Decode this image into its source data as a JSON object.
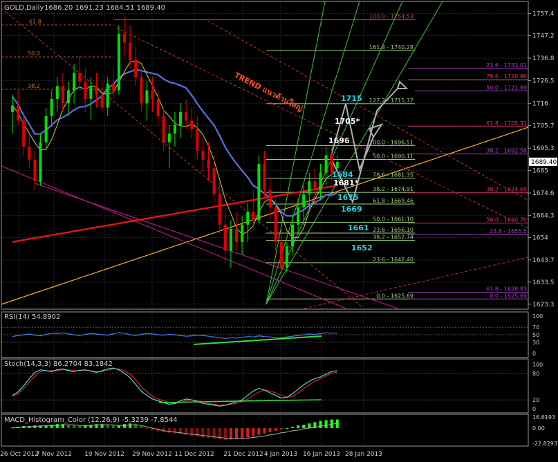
{
  "title": "GOLD,Daily",
  "ohlc_readout": "1686.20 1691.23 1684.51 1689.40",
  "colors": {
    "bg": "#000000",
    "grid": "#2b2b2b",
    "border": "#9a9a9a",
    "bull": "#00e000",
    "bear": "#e00000",
    "ma_blue": "#5a6ee6",
    "ma_red": "#e01818",
    "envelope": "#d01890",
    "fib": "#b05048",
    "trendline": "#ffb020",
    "channel": "#cc2222",
    "projection": "#b0b0b0",
    "fan": "#40c040",
    "cyan_label": "#2ad0e0",
    "white_label": "#ffffff"
  },
  "chart_data": [
    {
      "type": "candlestick",
      "name": "price",
      "x_ticks": [
        "26 Oct 2012",
        "7 Nov 2012",
        "19 Nov 2012",
        "29 Nov 2012",
        "11 Dec 2012",
        "21 Dec 2012",
        "4 Jan 2013",
        "16 Jan 2013",
        "28 Jan 2013"
      ],
      "y_ticks": [
        1757.4,
        1747.2,
        1736.8,
        1726.5,
        1716.0,
        1705.7,
        1695.3,
        1685.0,
        1674.6,
        1664.3,
        1654.0,
        1643.7,
        1633.5,
        1623.3
      ],
      "ylim": [
        1621.0,
        1763.0
      ],
      "current_price": "1689.40",
      "candles": [
        [
          1712,
          1720,
          1702,
          1715
        ],
        [
          1715,
          1722,
          1706,
          1708
        ],
        [
          1708,
          1712,
          1692,
          1696
        ],
        [
          1696,
          1702,
          1686,
          1690
        ],
        [
          1690,
          1694,
          1676,
          1680
        ],
        [
          1680,
          1702,
          1678,
          1698
        ],
        [
          1698,
          1714,
          1694,
          1710
        ],
        [
          1710,
          1722,
          1705,
          1718
        ],
        [
          1718,
          1728,
          1712,
          1724
        ],
        [
          1724,
          1730,
          1712,
          1716
        ],
        [
          1716,
          1726,
          1710,
          1722
        ],
        [
          1722,
          1734,
          1716,
          1730
        ],
        [
          1730,
          1738,
          1722,
          1726
        ],
        [
          1726,
          1732,
          1712,
          1718
        ],
        [
          1718,
          1728,
          1708,
          1724
        ],
        [
          1724,
          1730,
          1714,
          1720
        ],
        [
          1720,
          1726,
          1712,
          1714
        ],
        [
          1714,
          1728,
          1710,
          1725
        ],
        [
          1725,
          1732,
          1718,
          1722
        ],
        [
          1722,
          1752,
          1720,
          1748
        ],
        [
          1748,
          1756,
          1738,
          1744
        ],
        [
          1744,
          1752,
          1732,
          1736
        ],
        [
          1736,
          1742,
          1724,
          1728
        ],
        [
          1728,
          1732,
          1712,
          1716
        ],
        [
          1716,
          1726,
          1708,
          1722
        ],
        [
          1722,
          1728,
          1712,
          1718
        ],
        [
          1718,
          1722,
          1706,
          1710
        ],
        [
          1710,
          1714,
          1694,
          1698
        ],
        [
          1698,
          1706,
          1686,
          1702
        ],
        [
          1702,
          1712,
          1696,
          1706
        ],
        [
          1706,
          1716,
          1700,
          1712
        ],
        [
          1712,
          1718,
          1704,
          1708
        ],
        [
          1708,
          1714,
          1700,
          1704
        ],
        [
          1704,
          1710,
          1690,
          1694
        ],
        [
          1694,
          1700,
          1684,
          1690
        ],
        [
          1690,
          1698,
          1680,
          1686
        ],
        [
          1686,
          1692,
          1670,
          1674
        ],
        [
          1674,
          1680,
          1656,
          1660
        ],
        [
          1660,
          1668,
          1642,
          1648
        ],
        [
          1648,
          1662,
          1640,
          1658
        ],
        [
          1658,
          1666,
          1648,
          1652
        ],
        [
          1652,
          1664,
          1646,
          1660
        ],
        [
          1660,
          1670,
          1652,
          1666
        ],
        [
          1666,
          1676,
          1658,
          1662
        ],
        [
          1662,
          1692,
          1660,
          1688
        ],
        [
          1688,
          1694,
          1672,
          1676
        ],
        [
          1676,
          1682,
          1662,
          1668
        ],
        [
          1668,
          1672,
          1648,
          1652
        ],
        [
          1652,
          1658,
          1636,
          1640
        ],
        [
          1640,
          1652,
          1638,
          1650
        ],
        [
          1650,
          1664,
          1646,
          1660
        ],
        [
          1660,
          1672,
          1656,
          1668
        ],
        [
          1668,
          1678,
          1660,
          1674
        ],
        [
          1674,
          1684,
          1666,
          1680
        ],
        [
          1680,
          1686,
          1670,
          1676
        ],
        [
          1676,
          1688,
          1672,
          1684
        ],
        [
          1684,
          1696,
          1678,
          1692
        ],
        [
          1692,
          1696,
          1680,
          1684
        ],
        [
          1686,
          1692,
          1684,
          1689
        ]
      ]
    },
    {
      "type": "fibonacci_levels",
      "labels": [
        {
          "text": "100.0 - 1754.53",
          "price": 1754.5
        },
        {
          "text": "161.8 - 1740.28",
          "price": 1740.3
        },
        {
          "text": "23.6 - 1732.01",
          "price": 1732.0
        },
        {
          "text": "78.6 - 1726.96",
          "price": 1727.0
        },
        {
          "text": "50.0 - 1721.69",
          "price": 1721.7
        },
        {
          "text": "127.2 - 1715.77",
          "price": 1715.8
        },
        {
          "text": "61.8 - 1705.31",
          "price": 1705.3
        },
        {
          "text": "100.0 - 1696.51",
          "price": 1696.5
        },
        {
          "text": "38.2 - 1692.58",
          "price": 1692.6
        },
        {
          "text": "50.0 - 1690.11",
          "price": 1690.1
        },
        {
          "text": "78.6 - 1681.35",
          "price": 1681.4
        },
        {
          "text": "38.2 - 1674.91",
          "price": 1674.9
        },
        {
          "text": "38.2 - 1674.68",
          "price": 1674.7
        },
        {
          "text": "61.8 - 1669.46",
          "price": 1669.5
        },
        {
          "text": "50.0 - 1661.10",
          "price": 1661.1
        },
        {
          "text": "50.0 - 1660.70",
          "price": 1660.7
        },
        {
          "text": "23.6 - 1656.10",
          "price": 1656.1
        },
        {
          "text": "23.6 - 1655.5",
          "price": 1655.5
        },
        {
          "text": "38.2 - 1652.74",
          "price": 1652.7
        },
        {
          "text": "23.6 - 1642.40",
          "price": 1642.4
        },
        {
          "text": "61.8 - 1628.83",
          "price": 1628.8
        },
        {
          "text": "0.0 - 1625.69",
          "price": 1625.7
        },
        {
          "text": "0.0 - 1625.69",
          "price": 1625.7
        }
      ],
      "left_labels": [
        "61.8",
        "50.0",
        "38.2"
      ]
    },
    {
      "type": "annotations",
      "trend_text": "TREND แนวต้านใหญ่",
      "targets": [
        {
          "text": "1715",
          "color": "cyan"
        },
        {
          "text": "1705*",
          "color": "white"
        },
        {
          "text": "1696",
          "color": "white"
        },
        {
          "text": "1684",
          "color": "cyan"
        },
        {
          "text": "1681*",
          "color": "white"
        },
        {
          "text": "1675",
          "color": "cyan"
        },
        {
          "text": "1669",
          "color": "cyan"
        },
        {
          "text": "1661",
          "color": "cyan"
        },
        {
          "text": "1652",
          "color": "cyan"
        }
      ]
    },
    {
      "type": "line",
      "name": "RSI",
      "label": "RSI(14) 54.8902",
      "y_ticks": [
        "100",
        "70",
        "50",
        "30",
        "0"
      ],
      "ylim": [
        0,
        100
      ],
      "values": [
        45,
        48,
        50,
        52,
        49,
        47,
        51,
        54,
        53,
        55,
        52,
        50,
        48,
        51,
        53,
        52,
        50,
        49,
        52,
        56,
        54,
        50,
        48,
        51,
        53,
        52,
        50,
        49,
        51,
        50,
        48,
        46,
        47,
        49,
        48,
        46,
        44,
        42,
        40,
        42,
        41,
        43,
        45,
        44,
        47,
        45,
        44,
        43,
        42,
        44,
        46,
        48,
        50,
        52,
        51,
        53,
        55,
        54,
        55
      ]
    },
    {
      "type": "line",
      "name": "Stochastic",
      "label": "Stoch(14,3,3) 86.2704 83.1842",
      "y_ticks": [
        "100",
        "80",
        "20",
        "0"
      ],
      "ylim": [
        0,
        100
      ],
      "main": [
        30,
        38,
        52,
        68,
        82,
        88,
        86,
        84,
        88,
        90,
        86,
        84,
        87,
        88,
        85,
        82,
        86,
        90,
        92,
        88,
        80,
        70,
        55,
        40,
        30,
        22,
        18,
        14,
        10,
        12,
        18,
        22,
        20,
        16,
        12,
        10,
        8,
        6,
        8,
        12,
        16,
        20,
        30,
        40,
        46,
        42,
        36,
        30,
        24,
        26,
        34,
        44,
        54,
        62,
        68,
        72,
        78,
        84,
        86
      ],
      "signal": [
        28,
        34,
        46,
        60,
        74,
        84,
        86,
        86,
        86,
        88,
        88,
        86,
        86,
        87,
        86,
        84,
        84,
        87,
        90,
        90,
        86,
        78,
        66,
        50,
        38,
        28,
        22,
        18,
        14,
        12,
        14,
        18,
        20,
        18,
        16,
        12,
        10,
        8,
        8,
        10,
        12,
        16,
        22,
        30,
        38,
        42,
        40,
        36,
        30,
        26,
        28,
        36,
        46,
        54,
        62,
        68,
        74,
        80,
        83
      ]
    },
    {
      "type": "bar",
      "name": "MACD",
      "label": "MACD_Histogram_Color (12,26,9) -5.3239 -7.8544",
      "y_ticks": [
        "16.6193",
        "0.00",
        "-22.8293"
      ],
      "ylim": [
        -22.8293,
        16.6193
      ],
      "values": [
        1,
        2,
        3,
        3,
        4,
        4,
        4,
        5,
        6,
        6,
        5,
        4,
        3,
        4,
        5,
        6,
        6,
        5,
        4,
        4,
        6,
        7,
        6,
        3,
        -1,
        -3,
        -5,
        -6,
        -7,
        -8,
        -9,
        -10,
        -12,
        -13,
        -14,
        -15,
        -16,
        -17,
        -18,
        -17,
        -16,
        -15,
        -14,
        -12,
        -10,
        -8,
        -6,
        -4,
        -2,
        0,
        2,
        4,
        5,
        7,
        9,
        11,
        12,
        13,
        13
      ],
      "signal": [
        0,
        1,
        2,
        2,
        3,
        3,
        4,
        4,
        4,
        5,
        5,
        5,
        4,
        4,
        4,
        5,
        5,
        5,
        5,
        4,
        4,
        5,
        5,
        4,
        2,
        0,
        -2,
        -4,
        -5,
        -6,
        -7,
        -8,
        -9,
        -10,
        -11,
        -12,
        -13,
        -14,
        -15,
        -16,
        -16,
        -16,
        -15,
        -14,
        -13,
        -12,
        -10,
        -9,
        -7,
        -6,
        -4,
        -3,
        -1,
        0,
        1,
        3,
        4,
        6,
        7
      ]
    }
  ]
}
